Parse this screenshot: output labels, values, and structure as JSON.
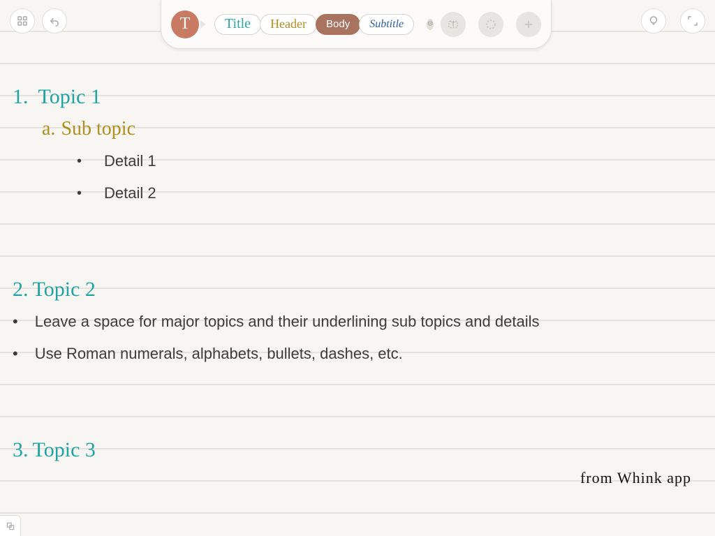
{
  "toolbar": {
    "text_badge": "T",
    "styles": {
      "title": "Title",
      "header": "Header",
      "body": "Body",
      "subtitle": "Subtitle"
    }
  },
  "doc": {
    "topic1_num": "1.",
    "topic1_label": "Topic 1",
    "sub_a_num": "a.",
    "sub_a_label": "Sub topic",
    "detail1": "Detail 1",
    "detail2": "Detail 2",
    "topic2_num": "2.",
    "topic2_label": "Topic 2",
    "tip1": "Leave a space for major topics and their underlining sub topics and details",
    "tip2": "Use Roman numerals, alphabets, bullets, dashes, etc.",
    "topic3_num": "3.",
    "topic3_label": "Topic 3",
    "signature": "from Whink app"
  }
}
